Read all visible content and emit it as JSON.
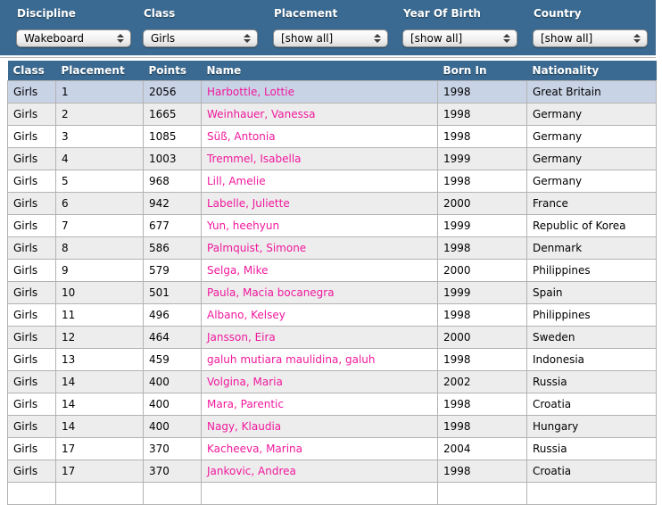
{
  "filters": [
    {
      "id": "discipline",
      "label": "Discipline",
      "value": "Wakeboard"
    },
    {
      "id": "class",
      "label": "Class",
      "value": "Girls"
    },
    {
      "id": "placement",
      "label": "Placement",
      "value": "[show all]"
    },
    {
      "id": "year_of_birth",
      "label": "Year Of Birth",
      "value": "[show all]"
    },
    {
      "id": "country",
      "label": "Country",
      "value": "[show all]"
    }
  ],
  "table": {
    "columns": [
      "Class",
      "Placement",
      "Points",
      "Name",
      "Born In",
      "Nationality"
    ],
    "highlighted_row_index": 0,
    "rows": [
      [
        "Girls",
        "1",
        "2056",
        "Harbottle, Lottie",
        "1998",
        "Great Britain"
      ],
      [
        "Girls",
        "2",
        "1665",
        "Weinhauer, Vanessa",
        "1998",
        "Germany"
      ],
      [
        "Girls",
        "3",
        "1085",
        "Süß, Antonia",
        "1998",
        "Germany"
      ],
      [
        "Girls",
        "4",
        "1003",
        "Tremmel, Isabella",
        "1999",
        "Germany"
      ],
      [
        "Girls",
        "5",
        "968",
        "Lill, Amelie",
        "1998",
        "Germany"
      ],
      [
        "Girls",
        "6",
        "942",
        "Labelle, Juliette",
        "2000",
        "France"
      ],
      [
        "Girls",
        "7",
        "677",
        "Yun, heehyun",
        "1999",
        "Republic of Korea"
      ],
      [
        "Girls",
        "8",
        "586",
        "Palmquist, Simone",
        "1998",
        "Denmark"
      ],
      [
        "Girls",
        "9",
        "579",
        "Selga, Mike",
        "2000",
        "Philippines"
      ],
      [
        "Girls",
        "10",
        "501",
        "Paula, Macia bocanegra",
        "1999",
        "Spain"
      ],
      [
        "Girls",
        "11",
        "496",
        "Albano, Kelsey",
        "1998",
        "Philippines"
      ],
      [
        "Girls",
        "12",
        "464",
        "Jansson, Eira",
        "2000",
        "Sweden"
      ],
      [
        "Girls",
        "13",
        "459",
        "galuh mutiara maulidina, galuh",
        "1998",
        "Indonesia"
      ],
      [
        "Girls",
        "14",
        "400",
        "Volgina, Maria",
        "2002",
        "Russia"
      ],
      [
        "Girls",
        "14",
        "400",
        "Mara, Parentic",
        "1998",
        "Croatia"
      ],
      [
        "Girls",
        "14",
        "400",
        "Nagy, Klaudia",
        "1998",
        "Hungary"
      ],
      [
        "Girls",
        "17",
        "370",
        "Kacheeva, Marina",
        "2004",
        "Russia"
      ],
      [
        "Girls",
        "17",
        "370",
        "Jankovic, Andrea",
        "1998",
        "Croatia"
      ],
      [
        "",
        "",
        "",
        "",
        "",
        ""
      ]
    ]
  },
  "colors": {
    "bar_blue": "#3a6a91",
    "link_pink": "#f0189c",
    "highlight_blue": "#c9d3e6",
    "alt_row": "#ededed"
  }
}
